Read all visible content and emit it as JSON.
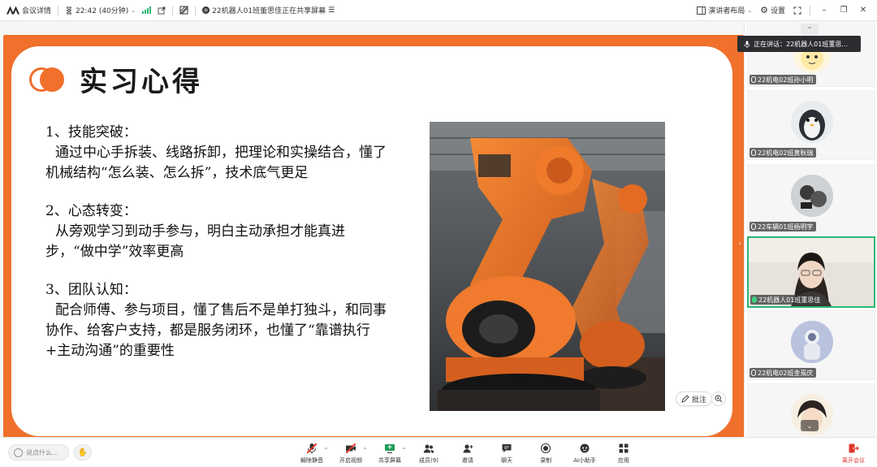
{
  "topbar": {
    "meeting_details": "会议详情",
    "duration": "22:42 (40分钟)",
    "sharing_status": "22机器人01班董思佳正在共享屏幕",
    "presenter_layout": "演讲者布局",
    "settings": "设置"
  },
  "slide": {
    "title": "实习心得",
    "sections": [
      {
        "heading": "1、技能突破：",
        "body": "通过中心手拆装、线路拆卸，把理论和实操结合，懂了机械结构“怎么装、怎么拆”，技术底气更足"
      },
      {
        "heading": "2、心态转变：",
        "body": "从旁观学习到动手参与，明白主动承担才能真进步，“做中学”效率更高"
      },
      {
        "heading": "3、团队认知：",
        "body": "配合师傅、参与项目，懂了售后不是单打独斗，和同事协作、给客户支持，都是服务闭环，也懂了“靠谱执行+主动沟通”的重要性"
      }
    ],
    "annotate_label": "批注"
  },
  "panel": {
    "speaking_label": "正在讲话：22机器人01班董思...",
    "participants": [
      {
        "name": "22机电02班孙小明",
        "active": false
      },
      {
        "name": "22机电02班黄秋瑞",
        "active": false
      },
      {
        "name": "22车辆01班杨明宇",
        "active": false
      },
      {
        "name": "22机器人01班董思佳",
        "active": true
      },
      {
        "name": "22机电02班金焉庆",
        "active": false
      }
    ]
  },
  "bottombar": {
    "chat_placeholder": "说点什么...",
    "tools": [
      {
        "label": "解除静音",
        "icon": "mic-muted-icon"
      },
      {
        "label": "开启视频",
        "icon": "camera-off-icon"
      },
      {
        "label": "共享屏幕",
        "icon": "screen-share-icon"
      },
      {
        "label": "成员(9)",
        "icon": "members-icon"
      },
      {
        "label": "邀请",
        "icon": "invite-icon"
      },
      {
        "label": "聊天",
        "icon": "chat-icon"
      },
      {
        "label": "录制",
        "icon": "record-icon"
      },
      {
        "label": "AI小助手",
        "icon": "ai-assistant-icon"
      },
      {
        "label": "应用",
        "icon": "apps-icon"
      }
    ],
    "leave_label": "离开会议"
  },
  "colors": {
    "accent": "#f0702c",
    "active_border": "#2bb673",
    "danger": "#e0352b"
  }
}
